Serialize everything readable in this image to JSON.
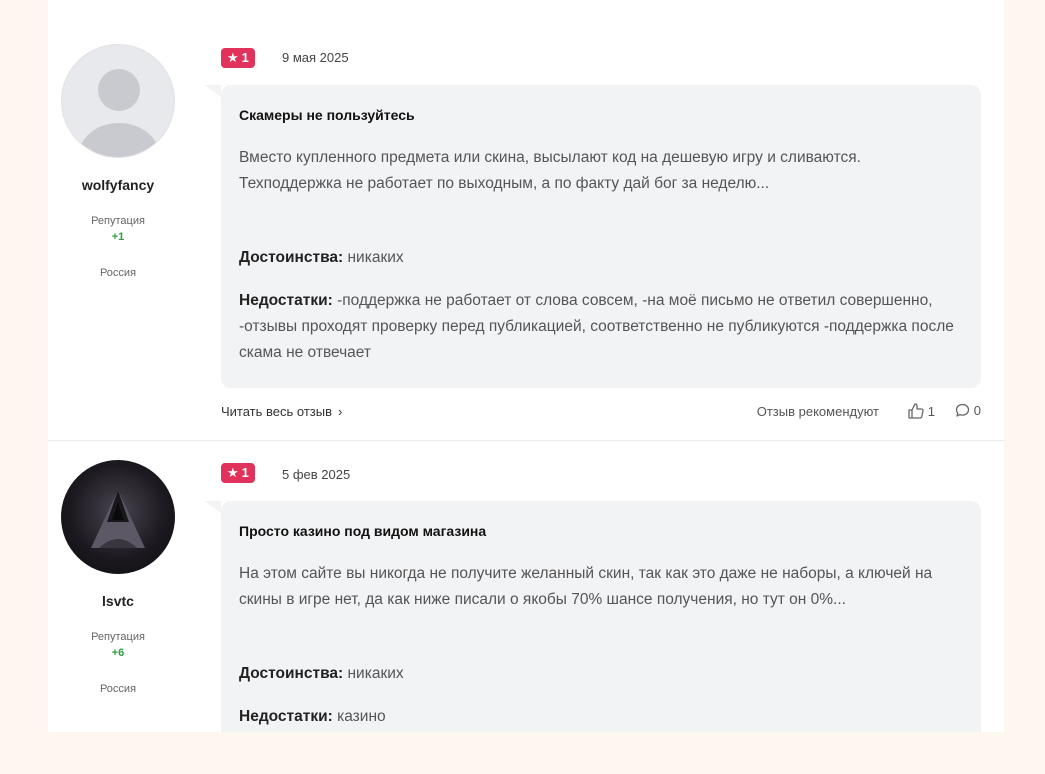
{
  "reviews": [
    {
      "author": {
        "name": "wolfyfancy",
        "reputation_label": "Репутация",
        "reputation_value": "+1",
        "country": "Россия",
        "avatar": "default-user-avatar"
      },
      "rating": "1",
      "date": "9 мая 2025",
      "title": "Скамеры не пользуйтесь",
      "text": "Вместо купленного предмета или скина, высылают код на дешевую игру и сливаются. Техподдержка не работает по выходным, а по факту дай бог за неделю...",
      "pros_label": "Достоинства:",
      "pros": "никаких",
      "cons_label": "Недостатки:",
      "cons": "-поддержка не работает от слова совсем, -на моё письмо не ответил совершенно, -отзывы проходят проверку перед публикацией, соответственно не публикуются -поддержка после скама не отвечает",
      "read_more": "Читать весь отзыв",
      "recommend_label": "Отзыв рекомендуют",
      "likes": "1",
      "comments": "0"
    },
    {
      "author": {
        "name": "lsvtc",
        "reputation_label": "Репутация",
        "reputation_value": "+6",
        "country": "Россия",
        "avatar": "hooded-figure-avatar"
      },
      "rating": "1",
      "date": "5 фев 2025",
      "title": "Просто казино под видом магазина",
      "text": "На этом сайте вы никогда не получите желанный скин, так как это даже не наборы, а ключей на скины в игре нет, да как ниже писали о якобы 70% шансе получения, но тут он 0%...",
      "pros_label": "Достоинства:",
      "pros": "никаких",
      "cons_label": "Недостатки:",
      "cons": "казино"
    }
  ],
  "colors": {
    "rating_badge": "#e0325b",
    "reputation_positive": "#2e9e3e",
    "bubble": "#f2f3f5",
    "page_bg": "#fdf7ef"
  }
}
